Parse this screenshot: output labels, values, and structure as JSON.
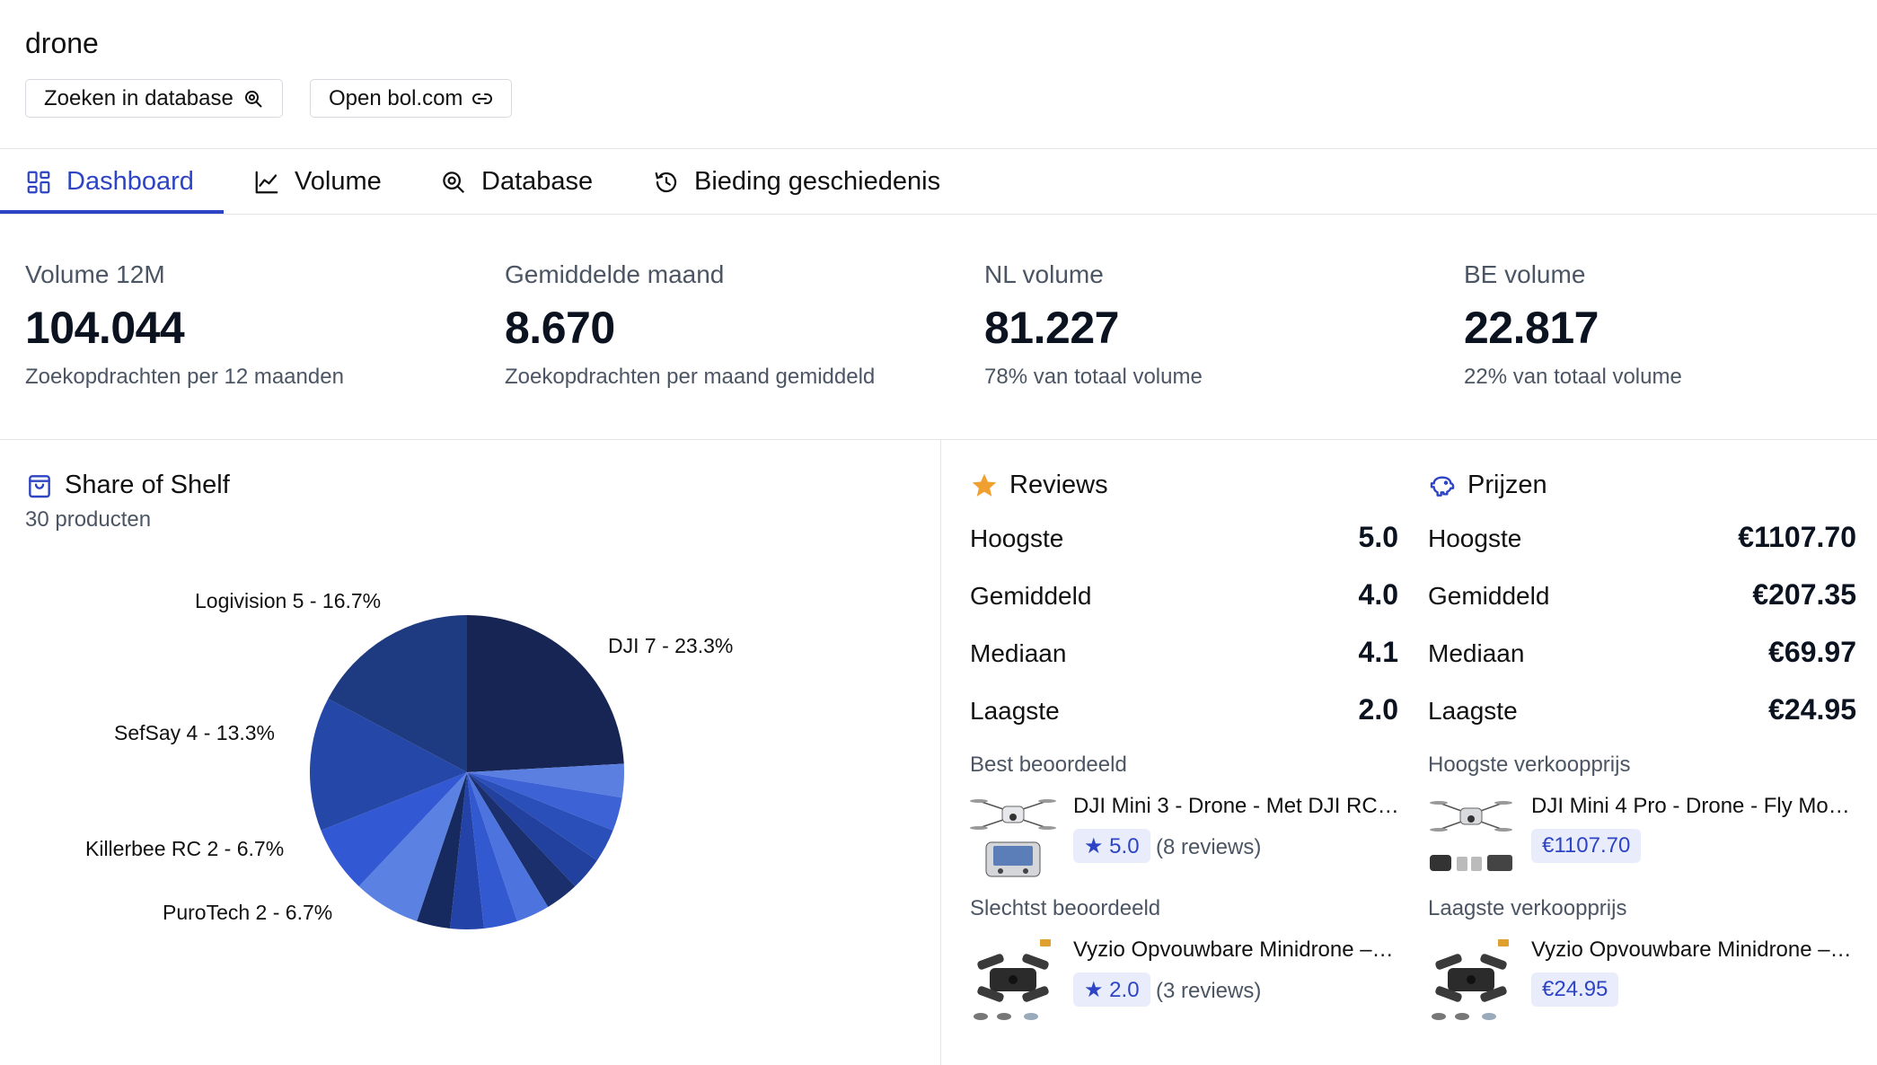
{
  "header": {
    "title": "drone",
    "search_db_label": "Zoeken in database",
    "open_bol_label": "Open bol.com"
  },
  "tabs": [
    {
      "label": "Dashboard",
      "icon": "dashboard-icon",
      "active": true
    },
    {
      "label": "Volume",
      "icon": "line-chart-icon",
      "active": false
    },
    {
      "label": "Database",
      "icon": "search-database-icon",
      "active": false
    },
    {
      "label": "Bieding geschiedenis",
      "icon": "history-icon",
      "active": false
    }
  ],
  "stats": [
    {
      "label": "Volume 12M",
      "value": "104.044",
      "sub": "Zoekopdrachten per 12 maanden"
    },
    {
      "label": "Gemiddelde maand",
      "value": "8.670",
      "sub": "Zoekopdrachten per maand gemiddeld"
    },
    {
      "label": "NL volume",
      "value": "81.227",
      "sub": "78% van totaal volume"
    },
    {
      "label": "BE volume",
      "value": "22.817",
      "sub": "22% van totaal volume"
    }
  ],
  "share": {
    "title": "Share of Shelf",
    "subtitle": "30 producten"
  },
  "chart_data": {
    "type": "pie",
    "slices": [
      {
        "name": "DJI",
        "count": 7,
        "percent": 23.3,
        "label": "DJI 7 - 23.3%",
        "color": "#172554"
      },
      {
        "name": "",
        "count": 1,
        "percent": 3.3,
        "label": "",
        "color": "#5a7fe0"
      },
      {
        "name": "",
        "count": 1,
        "percent": 3.3,
        "label": "",
        "color": "#3d62d6"
      },
      {
        "name": "",
        "count": 1,
        "percent": 3.3,
        "label": "",
        "color": "#2a4fb8"
      },
      {
        "name": "",
        "count": 1,
        "percent": 3.3,
        "label": "",
        "color": "#22409e"
      },
      {
        "name": "",
        "count": 1,
        "percent": 3.3,
        "label": "",
        "color": "#1a2f6b"
      },
      {
        "name": "",
        "count": 1,
        "percent": 3.3,
        "label": "",
        "color": "#4c73de"
      },
      {
        "name": "",
        "count": 1,
        "percent": 3.3,
        "label": "",
        "color": "#3359d0"
      },
      {
        "name": "",
        "count": 1,
        "percent": 3.3,
        "label": "",
        "color": "#2443a8"
      },
      {
        "name": "",
        "count": 1,
        "percent": 3.3,
        "label": "",
        "color": "#162a60"
      },
      {
        "name": "PuroTech",
        "count": 2,
        "percent": 6.7,
        "label": "PuroTech 2 - 6.7%",
        "color": "#5b82e2"
      },
      {
        "name": "Killerbee RC",
        "count": 2,
        "percent": 6.7,
        "label": "Killerbee RC 2 - 6.7%",
        "color": "#3358d4"
      },
      {
        "name": "SefSay",
        "count": 4,
        "percent": 13.3,
        "label": "SefSay 4 - 13.3%",
        "color": "#2547a8"
      },
      {
        "name": "Logivision",
        "count": 5,
        "percent": 16.7,
        "label": "Logivision 5 - 16.7%",
        "color": "#1e3a80"
      }
    ]
  },
  "reviews": {
    "title": "Reviews",
    "rows": [
      {
        "label": "Hoogste",
        "value": "5.0"
      },
      {
        "label": "Gemiddeld",
        "value": "4.0"
      },
      {
        "label": "Mediaan",
        "value": "4.1"
      },
      {
        "label": "Laagste",
        "value": "2.0"
      }
    ],
    "best": {
      "caption": "Best beoordeeld",
      "product": "DJI Mini 3 - Drone - Met DJI RC…",
      "rating": "★ 5.0",
      "reviews": "(8 reviews)"
    },
    "worst": {
      "caption": "Slechtst beoordeeld",
      "product": "Vyzio Opvouwbare Minidrone –…",
      "rating": "★ 2.0",
      "reviews": "(3 reviews)"
    }
  },
  "prices": {
    "title": "Prijzen",
    "rows": [
      {
        "label": "Hoogste",
        "value": "€1107.70"
      },
      {
        "label": "Gemiddeld",
        "value": "€207.35"
      },
      {
        "label": "Mediaan",
        "value": "€69.97"
      },
      {
        "label": "Laagste",
        "value": "€24.95"
      }
    ],
    "highest": {
      "caption": "Hoogste verkoopprijs",
      "product": "DJI Mini 4 Pro - Drone - Fly Mo…",
      "price": "€1107.70"
    },
    "lowest": {
      "caption": "Laagste verkoopprijs",
      "product": "Vyzio Opvouwbare Minidrone –…",
      "price": "€24.95"
    }
  }
}
